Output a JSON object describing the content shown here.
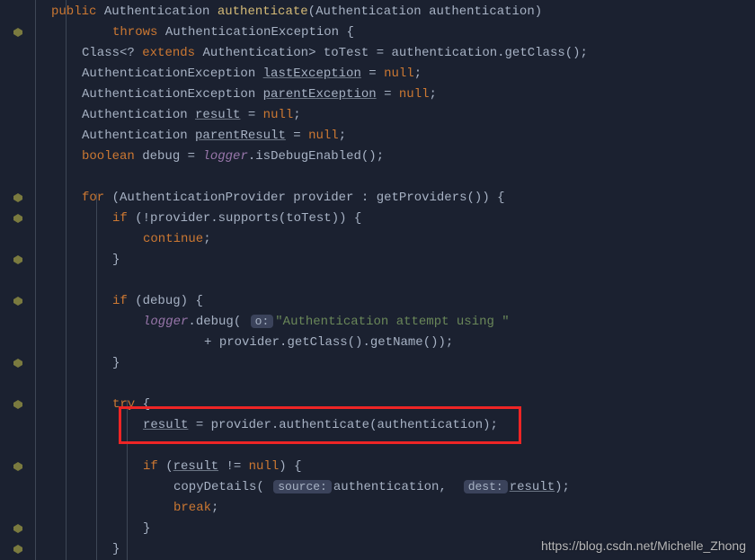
{
  "code": {
    "l1_public": "public",
    "l1_ret": " Authentication ",
    "l1_fn": "authenticate",
    "l1_op": "(",
    "l1_pty": "Authentication ",
    "l1_pn": "authentication",
    "l1_cp": ")",
    "l2_throws": "throws",
    "l2_ex": " AuthenticationException ",
    "l2_br": "{",
    "l3_ty": "Class",
    "l3_gen": "<? ",
    "l3_ext": "extends",
    "l3_gen2": " Authentication> ",
    "l3_v": "toTest ",
    "l3_eq": "= ",
    "l3_a": "authentication",
    "l3_dot": ".",
    "l3_m": "getClass",
    "l3_end": "();",
    "l4_ty": "AuthenticationException ",
    "l4_v": "lastException",
    "l4_eq": " = ",
    "l4_null": "null",
    "l4_sc": ";",
    "l5_ty": "AuthenticationException ",
    "l5_v": "parentException",
    "l5_eq": " = ",
    "l5_null": "null",
    "l5_sc": ";",
    "l6_ty": "Authentication ",
    "l6_v": "result",
    "l6_eq": " = ",
    "l6_null": "null",
    "l6_sc": ";",
    "l7_ty": "Authentication ",
    "l7_v": "parentResult",
    "l7_eq": " = ",
    "l7_null": "null",
    "l7_sc": ";",
    "l8_kw": "boolean ",
    "l8_v": "debug ",
    "l8_eq": "= ",
    "l8_log": "logger",
    "l8_dot": ".",
    "l8_m": "isDebugEnabled",
    "l8_end": "();",
    "l10_for": "for ",
    "l10_op": "(",
    "l10_ty": "AuthenticationProvider ",
    "l10_v": "provider ",
    "l10_col": ": ",
    "l10_m": "getProviders",
    "l10_c": "()",
    "l10_cp": ") {",
    "l11_if": "if ",
    "l11_op": "(!",
    "l11_v": "provider",
    "l11_d": ".",
    "l11_m": "supports",
    "l11_o2": "(",
    "l11_a": "toTest",
    "l11_c2": ")",
    "l11_cp": ") {",
    "l12_cont": "continue",
    "l12_sc": ";",
    "l13_cb": "}",
    "l15_if": "if ",
    "l15_op": "(",
    "l15_v": "debug",
    "l15_cp": ") {",
    "l16_log": "logger",
    "l16_d": ".",
    "l16_m": "debug",
    "l16_o": "( ",
    "l16_hint": "o:",
    "l16_s": "\"Authentication attempt using \"",
    "l17_plus": "+ ",
    "l17_v": "provider",
    "l17_d": ".",
    "l17_m1": "getClass",
    "l17_p1": "()",
    "l17_d2": ".",
    "l17_m2": "getName",
    "l17_p2": "()",
    "l17_end": ");",
    "l18_cb": "}",
    "l20_try": "try ",
    "l20_br": "{",
    "l21_v": "result",
    "l21_eq": " = ",
    "l21_p": "provider",
    "l21_d": ".",
    "l21_m": "authenticate",
    "l21_o": "(",
    "l21_a": "authentication",
    "l21_c": ")",
    "l21_sc": ";",
    "l23_if": "if ",
    "l23_o": "(",
    "l23_v": "result",
    "l23_ne": " != ",
    "l23_null": "null",
    "l23_c": ") {",
    "l24_m": "copyDetails",
    "l24_o": "( ",
    "l24_h1": "source:",
    "l24_a1": "authentication",
    "l24_cm": ",  ",
    "l24_h2": "dest:",
    "l24_a2": "result",
    "l24_e": ");",
    "l25_br": "break",
    "l25_sc": ";",
    "l26_cb": "}",
    "l27_cb": "}"
  },
  "watermark": "https://blog.csdn.net/Michelle_Zhong"
}
